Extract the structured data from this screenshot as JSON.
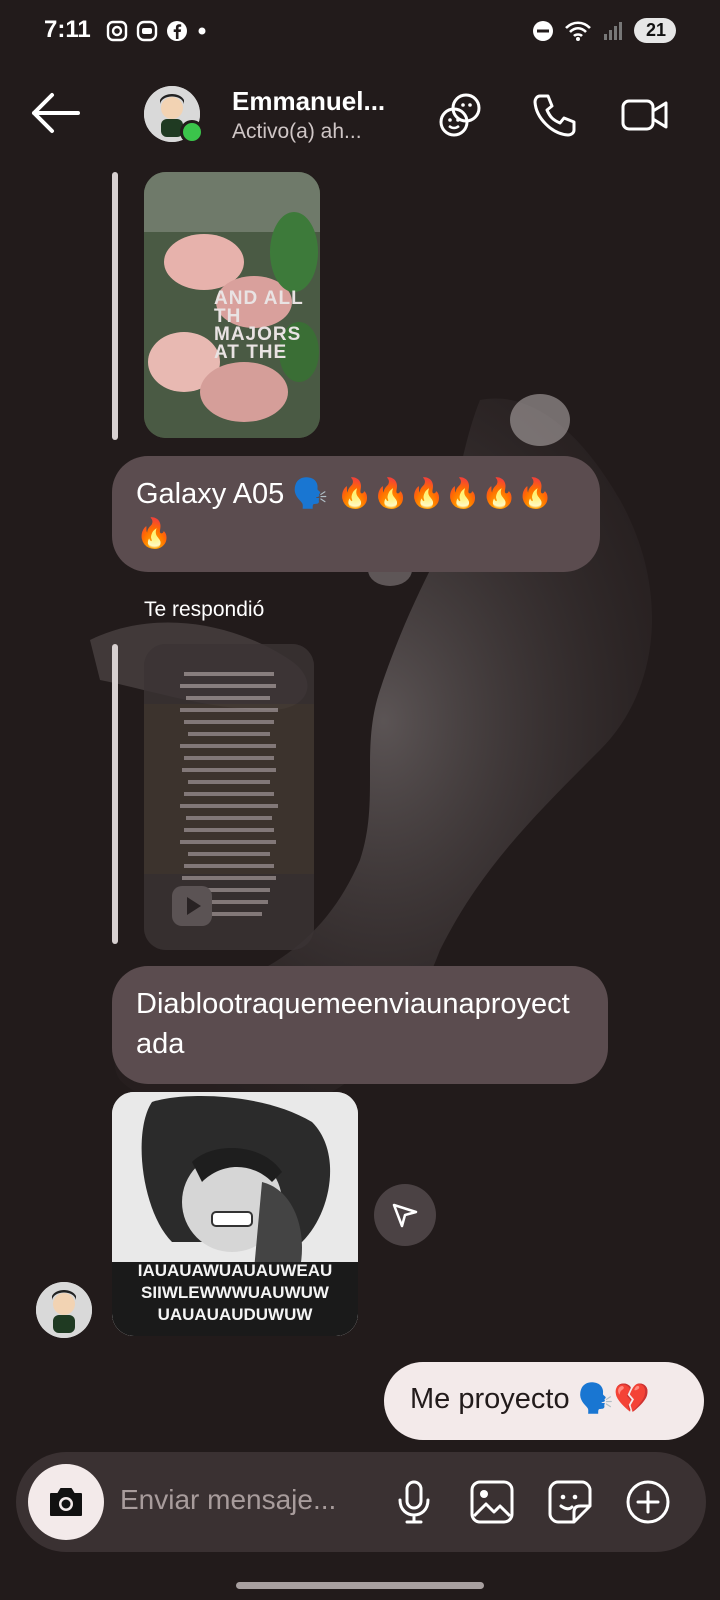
{
  "status_bar": {
    "time": "7:11",
    "battery": "21",
    "app_icons": [
      "instagram-icon",
      "messenger-icon",
      "facebook-icon"
    ]
  },
  "header": {
    "name": "Emmanuel...",
    "status": "Activo(a) ah..."
  },
  "messages": {
    "bubble1": "Galaxy A05 🗣️ 🔥🔥🔥🔥🔥🔥🔥",
    "reply_label": "Te respondió",
    "bubble2": "Diablootraquemeenviaunaproyectada",
    "image_caption_lines": [
      "IAUAUAWUAUAUWEAU",
      "SIIWLEWWWUAUWUW",
      "UAUAUAUDUWUW"
    ],
    "outgoing": "Me proyecto 🗣️💔",
    "story1_text_lines": [
      "AND ALL TH",
      "MAJORS",
      "AT THE"
    ]
  },
  "composer": {
    "placeholder": "Enviar mensaje..."
  },
  "colors": {
    "background": "#221b1b",
    "incoming_bubble": "#5b4c4f",
    "outgoing_bubble": "#f3eaea",
    "online_dot": "#3bc44b"
  }
}
